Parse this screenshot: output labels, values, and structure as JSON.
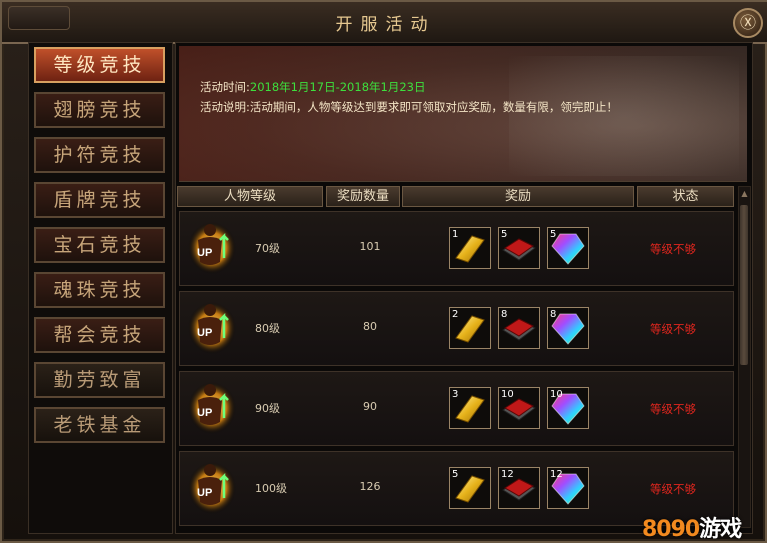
{
  "window": {
    "title": "开服活动",
    "close_glyph": "Ⓧ"
  },
  "sidebar": {
    "items": [
      {
        "label": "等级竞技",
        "state": "active"
      },
      {
        "label": "翅膀竞技",
        "state": "normal"
      },
      {
        "label": "护符竞技",
        "state": "normal"
      },
      {
        "label": "盾牌竞技",
        "state": "normal"
      },
      {
        "label": "宝石竞技",
        "state": "normal"
      },
      {
        "label": "魂珠竞技",
        "state": "normal"
      },
      {
        "label": "帮会竞技",
        "state": "normal"
      },
      {
        "label": "勤劳致富",
        "state": "dark"
      },
      {
        "label": "老铁基金",
        "state": "dark"
      }
    ]
  },
  "banner": {
    "time_label": "活动时间:",
    "time_value": "2018年1月17日-2018年1月23日",
    "desc_label": "活动说明:",
    "desc_value": "活动期间，人物等级达到要求即可领取对应奖励，数量有限，领完即止！"
  },
  "table": {
    "headers": [
      "人物等级",
      "奖励数量",
      "奖励",
      "状态"
    ],
    "rows": [
      {
        "level": "70级",
        "count": "101",
        "rewards": [
          "1",
          "5",
          "5"
        ],
        "status": "等级不够"
      },
      {
        "level": "80级",
        "count": "80",
        "rewards": [
          "2",
          "8",
          "8"
        ],
        "status": "等级不够"
      },
      {
        "level": "90级",
        "count": "90",
        "rewards": [
          "3",
          "10",
          "10"
        ],
        "status": "等级不够"
      },
      {
        "level": "100级",
        "count": "126",
        "rewards": [
          "5",
          "12",
          "12"
        ],
        "status": "等级不够"
      }
    ],
    "reward_icons": [
      "gold-bar-icon",
      "red-book-icon",
      "rainbow-gem-icon"
    ],
    "avatar_badge": "UP"
  },
  "watermark": {
    "digits": "8090",
    "suffix": "游戏"
  },
  "colors": {
    "accent": "#e7c991",
    "status_red": "#e0261e",
    "date_green": "#3de03d"
  }
}
